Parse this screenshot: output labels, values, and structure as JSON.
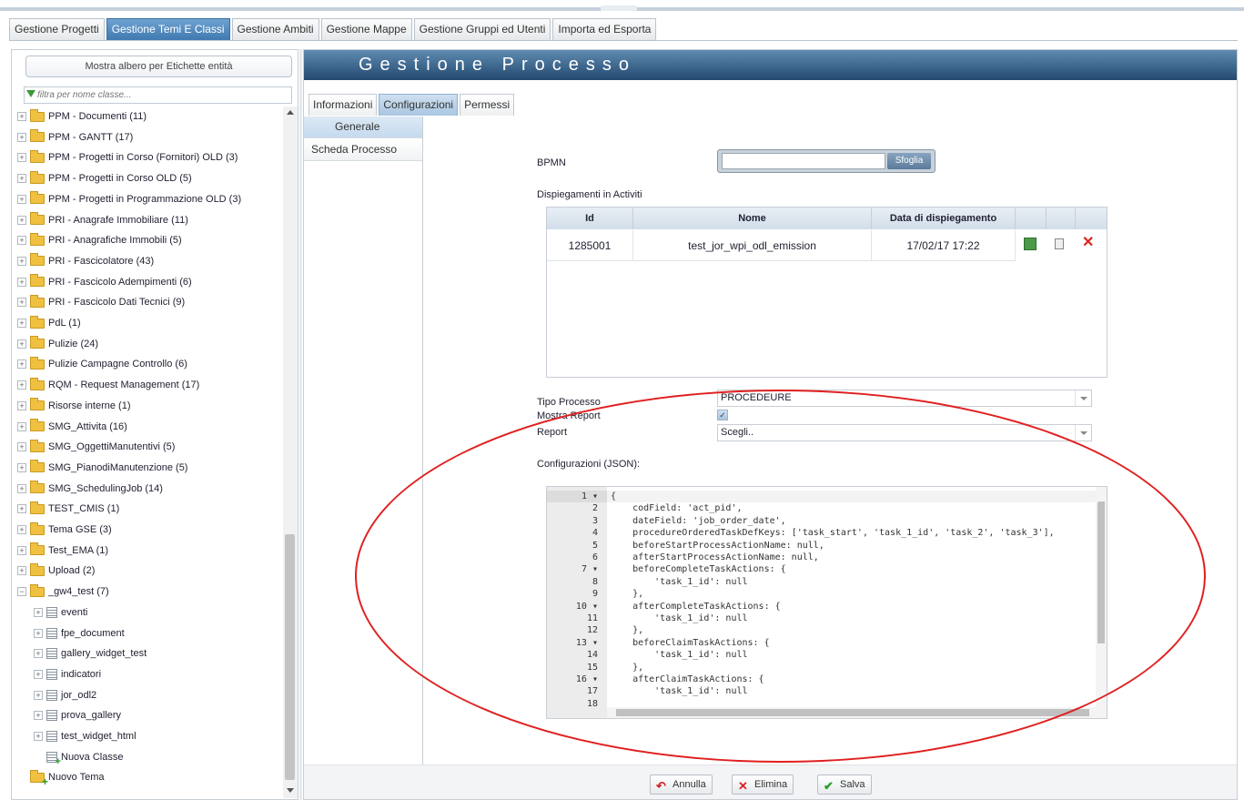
{
  "main_tabs": [
    "Gestione Progetti",
    "Gestione Temi E Classi",
    "Gestione Ambiti",
    "Gestione Mappe",
    "Gestione Gruppi ed Utenti",
    "Importa ed Esporta"
  ],
  "left_panel": {
    "show_tree_button": "Mostra albero per Etichette entità",
    "filter_placeholder": "filtra per nome classe...",
    "themes": [
      "PPM - Documenti (11)",
      "PPM - GANTT (17)",
      "PPM - Progetti in Corso (Fornitori) OLD (3)",
      "PPM - Progetti in Corso OLD (5)",
      "PPM - Progetti in Programmazione OLD (3)",
      "PRI - Anagrafe Immobiliare (11)",
      "PRI - Anagrafiche Immobili (5)",
      "PRI - Fascicolatore (43)",
      "PRI - Fascicolo Adempimenti (6)",
      "PRI - Fascicolo Dati Tecnici (9)",
      "PdL (1)",
      "Pulizie (24)",
      "Pulizie Campagne Controllo (6)",
      "RQM - Request Management (17)",
      "Risorse interne (1)",
      "SMG_Attivita (16)",
      "SMG_OggettiManutentivi (5)",
      "SMG_PianodiManutenzione (5)",
      "SMG_SchedulingJob (14)",
      "TEST_CMIS (1)",
      "Tema GSE (3)",
      "Test_EMA (1)",
      "Upload (2)",
      "_gw4_test (7)"
    ],
    "classes": [
      "eventi",
      "fpe_document",
      "gallery_widget_test",
      "indicatori",
      "jor_odl2",
      "prova_gallery",
      "test_widget_html"
    ],
    "new_class": "Nuova Classe",
    "new_theme": "Nuovo Tema"
  },
  "right_panel": {
    "title": "Gestione Processo",
    "sub_tabs": [
      "Informazioni",
      "Configurazioni",
      "Permessi"
    ],
    "side_tabs": [
      "Generale",
      "Scheda Processo"
    ],
    "bpmn_label": "BPMN",
    "browse_button": "Sfoglia",
    "deployments_label": "Dispiegamenti in Activiti",
    "grid": {
      "headers": [
        "Id",
        "Nome",
        "Data di dispiegamento"
      ],
      "rows": [
        {
          "id": "1285001",
          "nome": "test_jor_wpi_odl_emission",
          "data": "17/02/17 17:22"
        }
      ]
    },
    "tipo_processo_label": "Tipo Processo",
    "tipo_processo_value": "PROCEDEURE",
    "mostra_report_label": "Mostra Report",
    "report_label": "Report",
    "report_value": "Scegli..",
    "json_label": "Configurazioni (JSON):",
    "code_lines": [
      "{",
      "    codField: 'act_pid',",
      "    dateField: 'job_order_date',",
      "    procedureOrderedTaskDefKeys: ['task_start', 'task_1_id', 'task_2', 'task_3'],",
      "    beforeStartProcessActionName: null,",
      "    afterStartProcessActionName: null,",
      "    beforeCompleteTaskActions: {",
      "        'task_1_id': null",
      "    },",
      "    afterCompleteTaskActions: {",
      "        'task_1_id': null",
      "    },",
      "    beforeClaimTaskActions: {",
      "        'task_1_id': null",
      "    },",
      "    afterClaimTaskActions: {",
      "        'task_1_id': null",
      ""
    ],
    "line_numbers": [
      "1 ▾",
      "2",
      "3",
      "4",
      "5",
      "6",
      "7 ▾",
      "8",
      "9",
      "10 ▾",
      "11",
      "12",
      "13 ▾",
      "14",
      "15",
      "16 ▾",
      "17",
      "18"
    ],
    "footer_buttons": [
      "Annulla",
      "Elimina",
      "Salva"
    ]
  },
  "colors": {
    "header_dark": "#23496f",
    "active_tab": "#3f79b0",
    "annotation": "#e02020"
  }
}
